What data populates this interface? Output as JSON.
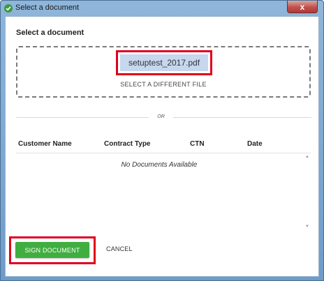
{
  "window": {
    "title": "Select a document",
    "close_glyph": "x"
  },
  "dialog": {
    "heading": "Select a document",
    "file_name": "setuptest_2017.pdf",
    "select_different_label": "SELECT A DIFFERENT FILE",
    "or_label": "OR"
  },
  "table": {
    "columns": [
      "Customer Name",
      "Contract Type",
      "CTN",
      "Date"
    ],
    "empty_message": "No Documents Available"
  },
  "actions": {
    "sign_label": "SIGN DOCUMENT",
    "cancel_label": "CANCEL"
  },
  "colors": {
    "accent_green": "#3fae3f",
    "highlight_red": "#e0001b",
    "file_chip_bg": "#c6d7ee"
  }
}
